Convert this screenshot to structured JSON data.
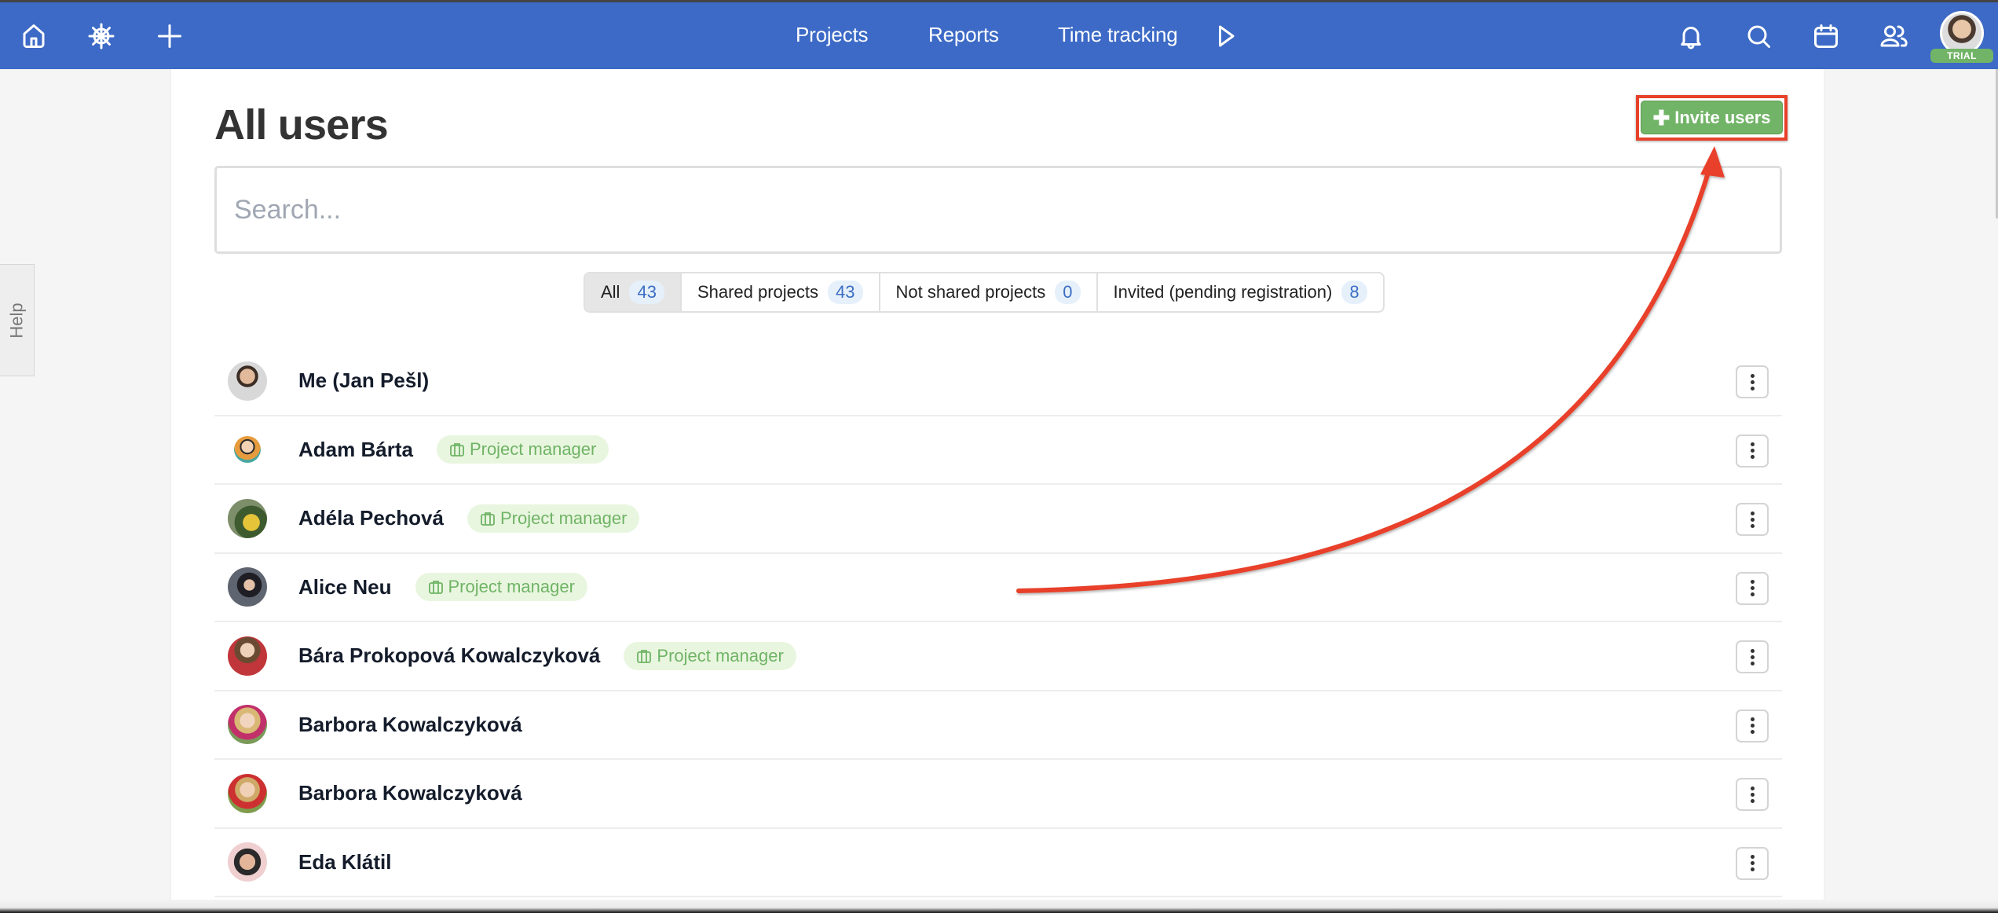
{
  "nav": {
    "left_icons": [
      "home-icon",
      "helm-icon",
      "plus-icon"
    ],
    "links": [
      "Projects",
      "Reports",
      "Time tracking"
    ],
    "play_icon": "play-icon",
    "right_icons": [
      "bell-icon",
      "search-icon",
      "calendar-icon",
      "users-icon"
    ],
    "trial_label": "TRIAL"
  },
  "help": {
    "label": "Help"
  },
  "page": {
    "title": "All users",
    "invite_label": "Invite users",
    "search_placeholder": "Search..."
  },
  "tabs": [
    {
      "label": "All",
      "count": "43",
      "active": true
    },
    {
      "label": "Shared projects",
      "count": "43"
    },
    {
      "label": "Not shared projects",
      "count": "0"
    },
    {
      "label": "Invited (pending registration)",
      "count": "8"
    }
  ],
  "users": [
    {
      "name": "Me (Jan Pešl)",
      "role": ""
    },
    {
      "name": "Adam Bárta",
      "role": "Project manager"
    },
    {
      "name": "Adéla Pechová",
      "role": "Project manager"
    },
    {
      "name": "Alice Neu",
      "role": "Project manager"
    },
    {
      "name": "Bára Prokopová Kowalczyková",
      "role": "Project manager"
    },
    {
      "name": "Barbora Kowalczyková",
      "role": ""
    },
    {
      "name": "Barbora Kowalczyková",
      "role": ""
    },
    {
      "name": "Eda Klátil",
      "role": ""
    }
  ],
  "colors": {
    "nav": "#3c6ac6",
    "invite_button": "#72b467",
    "annotation": "#e8412a",
    "badge_bg": "#e9f6df",
    "badge_text": "#6fb466",
    "count_text": "#3b6ec3"
  }
}
